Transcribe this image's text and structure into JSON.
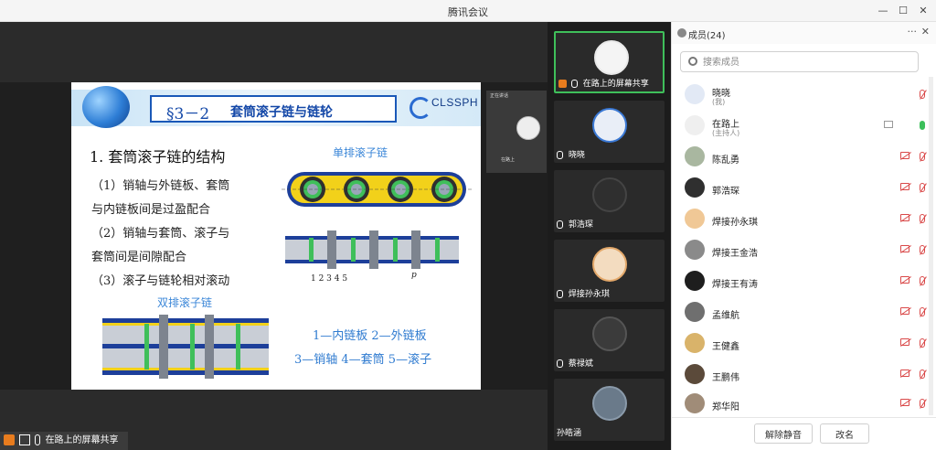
{
  "window": {
    "title": "腾讯会议",
    "min": "—",
    "max": "☐",
    "close": "✕"
  },
  "stage": {
    "share_status": "在路上的屏幕共享",
    "presenter_tile": {
      "header": "正在讲话",
      "name": "在路上"
    }
  },
  "slide": {
    "title_num": "§3－2",
    "title": "套筒滚子链与链轮",
    "logo_text": "CLSSPH",
    "section": "1. 套筒滚子链的结构",
    "lines": [
      "（1）销轴与外链板、套筒",
      "与内链板间是过盈配合",
      "（2）销轴与套筒、滚子与",
      "套筒间是间隙配合",
      "（3）滚子与链轮相对滚动"
    ],
    "single_chain_label": "单排滚子链",
    "double_chain_label": "双排滚子链",
    "part_numbers": "1  2 3    4 5",
    "pitch_label": "p",
    "legend_1": "1—内链板   2—外链板",
    "legend_2": "3—销轴   4—套筒   5—滚子"
  },
  "video_tiles": [
    {
      "name": "在路上的屏幕共享",
      "active": true
    },
    {
      "name": "晓晓"
    },
    {
      "name": "郭浩琛"
    },
    {
      "name": "焊接孙永琪"
    },
    {
      "name": "蔡禄斌"
    },
    {
      "name": "孙皓涵"
    }
  ],
  "panel": {
    "title": "成员(24)",
    "more": "···",
    "close": "✕",
    "search_placeholder": "搜索成员",
    "members": [
      {
        "name": "晓晓",
        "role": "(我)"
      },
      {
        "name": "在路上",
        "role": "(主持人)"
      },
      {
        "name": "陈乱勇"
      },
      {
        "name": "郭浩琛"
      },
      {
        "name": "焊接孙永琪"
      },
      {
        "name": "焊接王金浩"
      },
      {
        "name": "焊接王有涛"
      },
      {
        "name": "孟维航"
      },
      {
        "name": "王健鑫"
      },
      {
        "name": "王鹏伟"
      },
      {
        "name": "郑华阳"
      }
    ],
    "mute_all": "解除静音",
    "rename": "改名"
  },
  "colors": {
    "active_border": "#3fbf5a",
    "muted_red": "#d94848",
    "slide_blue": "#1448a8"
  }
}
